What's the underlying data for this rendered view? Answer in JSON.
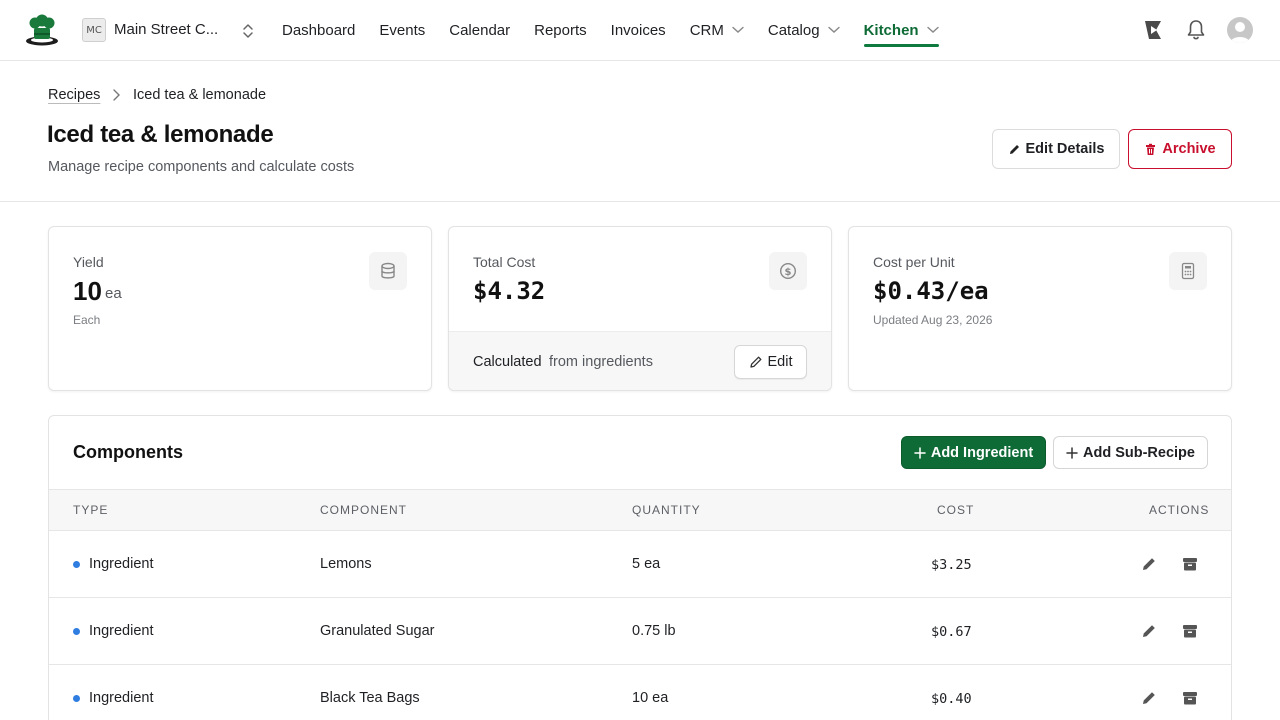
{
  "nav": {
    "org_initials": "MC",
    "org_name": "Main Street C...",
    "items": [
      {
        "label": "Dashboard",
        "has_menu": false,
        "active": false
      },
      {
        "label": "Events",
        "has_menu": false,
        "active": false
      },
      {
        "label": "Calendar",
        "has_menu": false,
        "active": false
      },
      {
        "label": "Reports",
        "has_menu": false,
        "active": false
      },
      {
        "label": "Invoices",
        "has_menu": false,
        "active": false
      },
      {
        "label": "CRM",
        "has_menu": true,
        "active": false
      },
      {
        "label": "Catalog",
        "has_menu": true,
        "active": false
      },
      {
        "label": "Kitchen",
        "has_menu": true,
        "active": true
      }
    ],
    "right_icons": [
      "feedback-icon",
      "bell-icon",
      "user-avatar-icon"
    ]
  },
  "breadcrumb": {
    "parent": "Recipes",
    "current": "Iced tea & lemonade"
  },
  "header": {
    "title": "Iced tea & lemonade",
    "subtitle": "Manage recipe components and calculate costs",
    "edit_details_label": "Edit Details",
    "archive_label": "Archive"
  },
  "stats": {
    "yield": {
      "label": "Yield",
      "value": "10",
      "unit": "ea",
      "sub": "Each",
      "icon": "database-icon"
    },
    "total_cost": {
      "label": "Total Cost",
      "value": "$4.32",
      "footer_strong": "Calculated",
      "footer_rest": "from ingredients",
      "edit_label": "Edit",
      "icon": "dollar-circle-icon"
    },
    "cost_per_unit": {
      "label": "Cost per Unit",
      "value": "$0.43/ea",
      "sub": "Updated Aug 23, 2026",
      "icon": "calculator-icon"
    }
  },
  "components": {
    "title": "Components",
    "add_ingredient_label": "Add Ingredient",
    "add_subrecipe_label": "Add Sub-Recipe",
    "columns": [
      "TYPE",
      "COMPONENT",
      "QUANTITY",
      "COST",
      "ACTIONS"
    ],
    "rows": [
      {
        "type": "Ingredient",
        "component": "Lemons",
        "quantity": "5 ea",
        "cost": "$3.25"
      },
      {
        "type": "Ingredient",
        "component": "Granulated Sugar",
        "quantity": "0.75 lb",
        "cost": "$0.67"
      },
      {
        "type": "Ingredient",
        "component": "Black Tea Bags",
        "quantity": "10 ea",
        "cost": "$0.40"
      }
    ]
  },
  "colors": {
    "brand_green": "#0e6b36",
    "danger_red": "#c8102e",
    "ingredient_dot": "#2f7de1"
  }
}
